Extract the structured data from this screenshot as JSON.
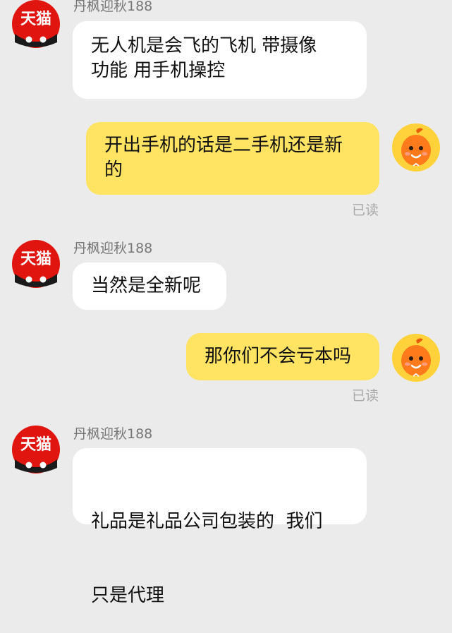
{
  "theme": {
    "background": "#ebebeb",
    "incoming_bubble": "#ffffff",
    "outgoing_bubble": "#ffe363",
    "tmall_red": "#e1150f"
  },
  "contact": {
    "name": "丹枫迎秋188",
    "avatar_text": "天猫",
    "avatar_icon": "tmall-logo-icon"
  },
  "me": {
    "avatar_icon": "orange-mascot-icon"
  },
  "messages": [
    {
      "from": "contact",
      "sender": "丹枫迎秋188",
      "lines": [
        "无人机是会飞的飞机 带摄像",
        "功能 用手机操控"
      ]
    },
    {
      "from": "me",
      "lines": [
        "开出手机的话是二手机还是新",
        "的"
      ],
      "status": "已读"
    },
    {
      "from": "contact",
      "sender": "丹枫迎秋188",
      "lines": [
        "当然是全新呢"
      ]
    },
    {
      "from": "me",
      "lines": [
        "那你们不会亏本吗"
      ],
      "status": "已读"
    },
    {
      "from": "contact",
      "sender": "丹枫迎秋188",
      "lines": [
        "礼品是礼品公司包装的  我们",
        "只是代理"
      ]
    }
  ]
}
